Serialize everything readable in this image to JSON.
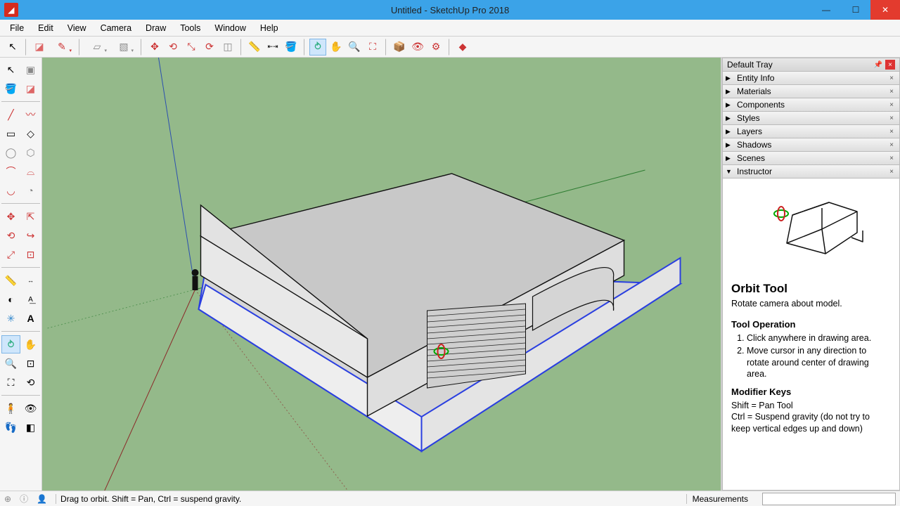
{
  "app": {
    "title": "Untitled - SketchUp Pro 2018"
  },
  "menus": [
    "File",
    "Edit",
    "View",
    "Camera",
    "Draw",
    "Tools",
    "Window",
    "Help"
  ],
  "tray": {
    "title": "Default Tray",
    "panels": [
      "Entity Info",
      "Materials",
      "Components",
      "Styles",
      "Layers",
      "Shadows",
      "Scenes",
      "Instructor"
    ]
  },
  "instructor": {
    "title": "Orbit Tool",
    "subtitle": "Rotate camera about model.",
    "op_heading": "Tool Operation",
    "ops": [
      "Click anywhere in drawing area.",
      "Move cursor in any direction to rotate around center of drawing area."
    ],
    "mod_heading": "Modifier Keys",
    "mod1": "Shift = Pan Tool",
    "mod2": "Ctrl = Suspend gravity (do not try to keep vertical edges up and down)"
  },
  "status": {
    "hint": "Drag to orbit. Shift = Pan, Ctrl = suspend gravity.",
    "measure_label": "Measurements"
  },
  "colors": {
    "accent": "#3ba3e8",
    "viewport": "#94b98a"
  }
}
